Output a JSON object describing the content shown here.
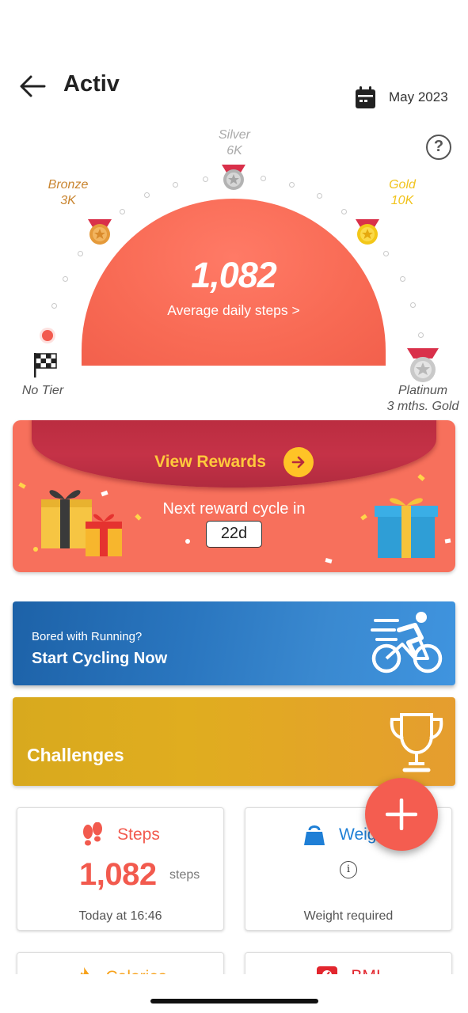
{
  "header": {
    "title": "Activ",
    "date": "May 2023"
  },
  "gauge": {
    "value": "1,082",
    "label": "Average daily steps  >",
    "tiers": [
      {
        "name": "No Tier",
        "threshold": ""
      },
      {
        "name": "Bronze",
        "threshold": "3K"
      },
      {
        "name": "Silver",
        "threshold": "6K"
      },
      {
        "name": "Gold",
        "threshold": "10K"
      },
      {
        "name": "Platinum",
        "threshold": "3 mths. Gold"
      }
    ],
    "colors": {
      "dome": "#f86a54",
      "bronze": "#d98a2b",
      "silver": "#bdbdbd",
      "gold": "#f3c718"
    }
  },
  "rewards": {
    "button_label": "View Rewards",
    "cycle_label": "Next reward cycle in",
    "cycle_days": "22d"
  },
  "cycling": {
    "subtitle": "Bored with Running?",
    "title": "Start Cycling Now"
  },
  "challenges": {
    "title": "Challenges"
  },
  "cards": {
    "steps": {
      "label": "Steps",
      "value": "1,082",
      "unit": "steps",
      "footer": "Today at 16:46"
    },
    "weight": {
      "label": "Weig",
      "footer": "Weight required",
      "info": "i"
    },
    "calories": {
      "label": "Calories"
    },
    "bmi": {
      "label": "BMI"
    }
  },
  "fab": {
    "icon": "plus-icon"
  },
  "colors": {
    "accent": "#f25a4e",
    "reward_yellow": "#ffc93c",
    "cycling_blue": "#2a76bf",
    "challenges_gold": "#e0ad1f"
  }
}
